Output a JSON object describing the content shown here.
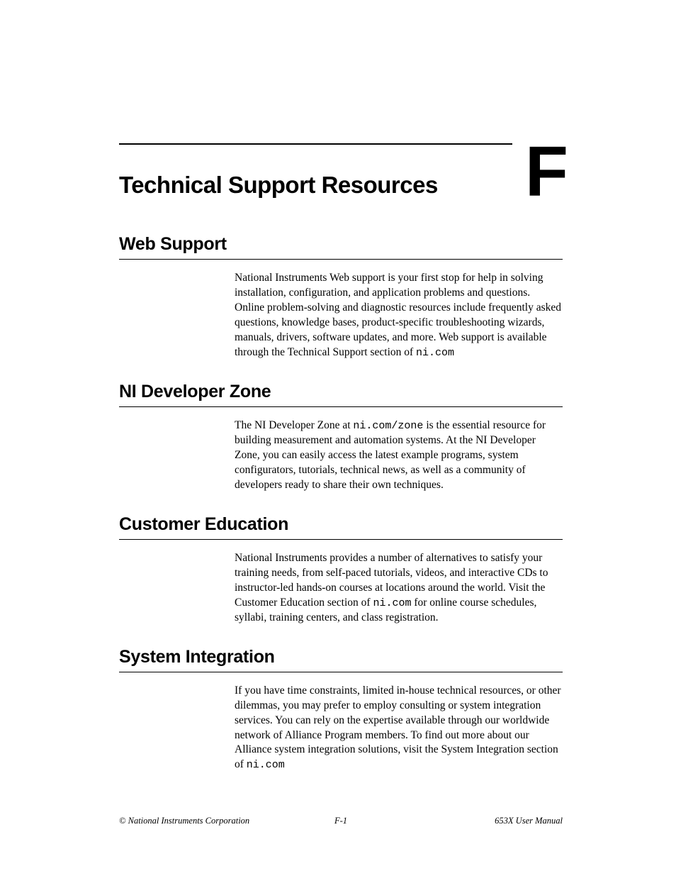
{
  "appendix_letter": "F",
  "title": "Technical Support Resources",
  "sections": {
    "web_support": {
      "heading": "Web Support",
      "body_pre": "National Instruments Web support is your first stop for help in solving installation, configuration, and application problems and questions. Online problem-solving and diagnostic resources include frequently asked questions, knowledge bases, product-specific troubleshooting wizards, manuals, drivers, software updates, and more. Web support is available through the Technical Support section of ",
      "body_mono": "ni.com"
    },
    "developer_zone": {
      "heading": "NI Developer Zone",
      "body_pre": "The NI Developer Zone at ",
      "body_mono": "ni.com/zone",
      "body_post": " is the essential resource for building measurement and automation systems. At the NI Developer Zone, you can easily access the latest example programs, system configurators, tutorials, technical news, as well as a community of developers ready to share their own techniques."
    },
    "customer_education": {
      "heading": "Customer Education",
      "body_pre": "National Instruments provides a number of alternatives to satisfy your training needs, from self-paced tutorials, videos, and interactive CDs to instructor-led hands-on courses at locations around the world. Visit the Customer Education section of ",
      "body_mono": "ni.com",
      "body_post": " for online course schedules, syllabi, training centers, and class registration."
    },
    "system_integration": {
      "heading": "System Integration",
      "body_pre": "If you have time constraints, limited in-house technical resources, or other dilemmas, you may prefer to employ consulting or system integration services. You can rely on the expertise available through our worldwide network of Alliance Program members. To find out more about our Alliance system integration solutions, visit the System Integration section of ",
      "body_mono": "ni.com"
    }
  },
  "footer": {
    "left": "© National Instruments Corporation",
    "center": "F-1",
    "right": "653X User Manual"
  }
}
